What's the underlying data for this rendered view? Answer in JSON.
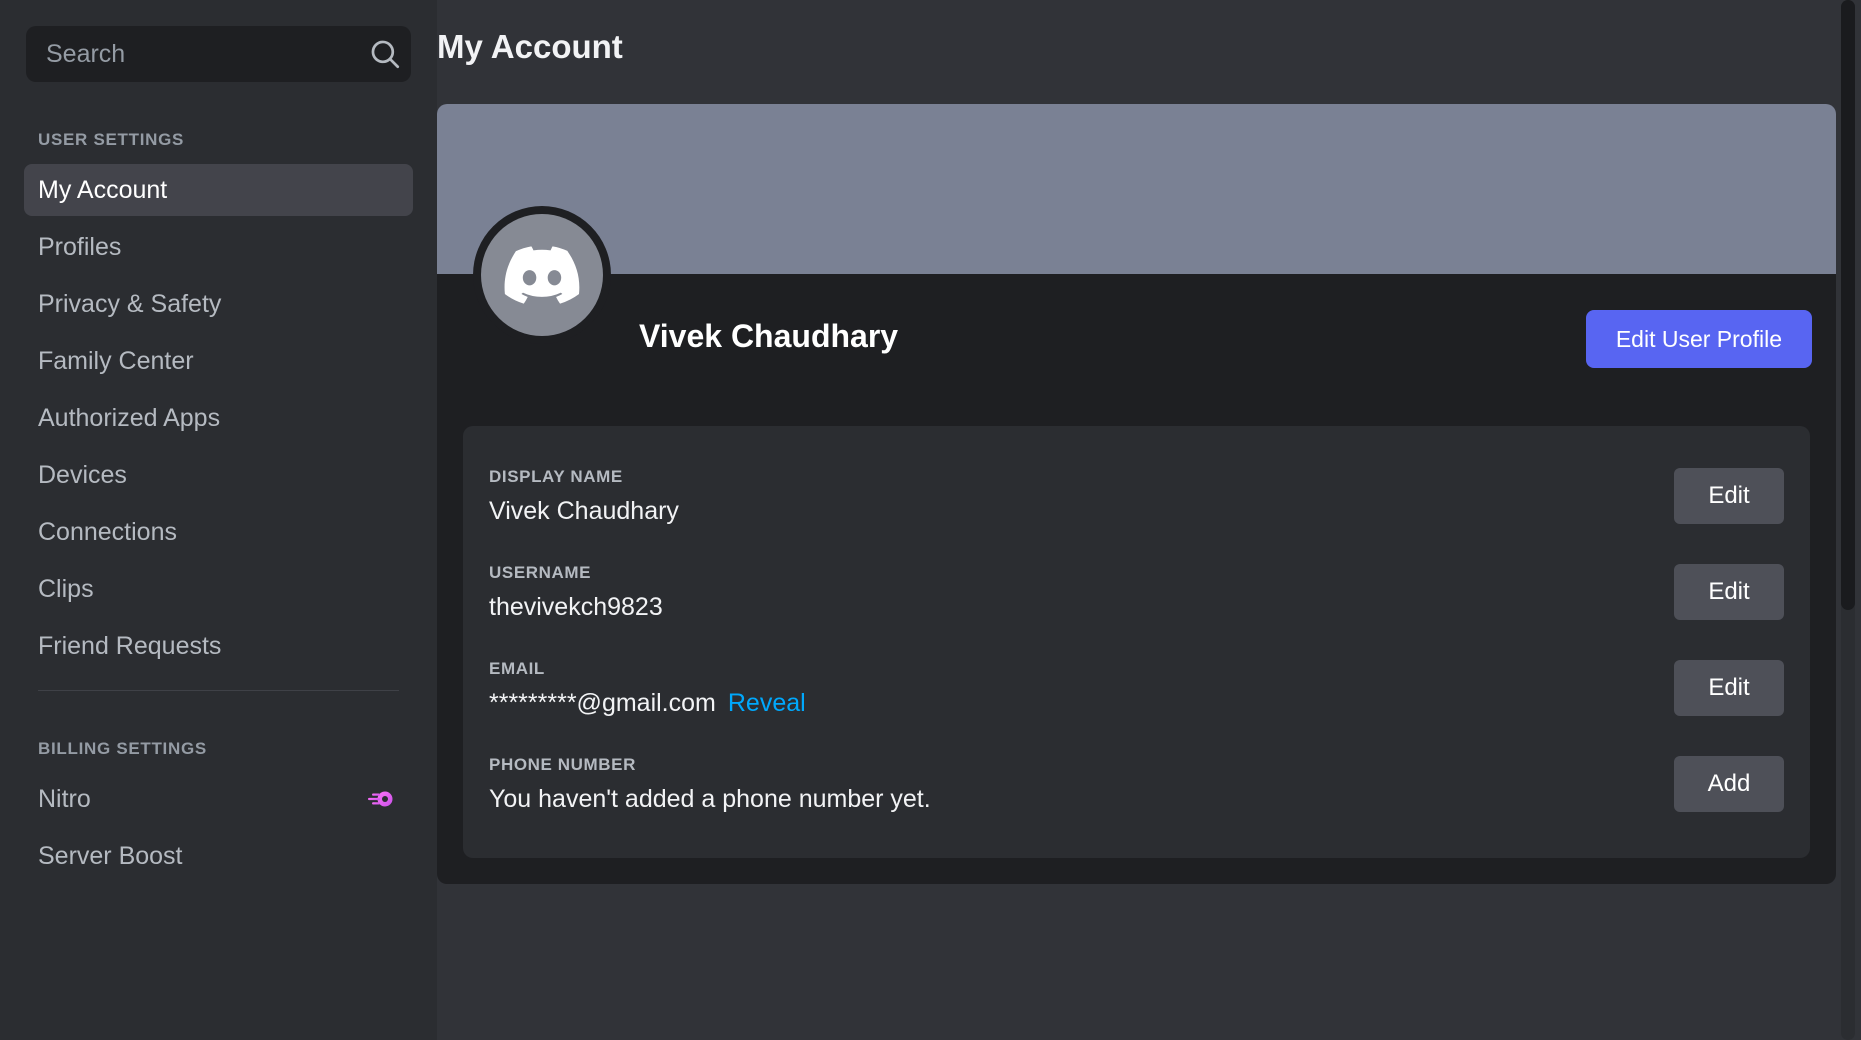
{
  "sidebar": {
    "search": {
      "placeholder": "Search",
      "value": "",
      "icon": "search-icon"
    },
    "sections": [
      {
        "heading": "USER SETTINGS",
        "items": [
          {
            "label": "My Account",
            "active": true
          },
          {
            "label": "Profiles",
            "active": false
          },
          {
            "label": "Privacy & Safety",
            "active": false
          },
          {
            "label": "Family Center",
            "active": false
          },
          {
            "label": "Authorized Apps",
            "active": false
          },
          {
            "label": "Devices",
            "active": false
          },
          {
            "label": "Connections",
            "active": false
          },
          {
            "label": "Clips",
            "active": false
          },
          {
            "label": "Friend Requests",
            "active": false
          }
        ]
      },
      {
        "heading": "BILLING SETTINGS",
        "items": [
          {
            "label": "Nitro",
            "active": false,
            "badge": "nitro-boost-icon"
          },
          {
            "label": "Server Boost",
            "active": false
          }
        ]
      }
    ]
  },
  "main": {
    "page_title": "My Account",
    "profile": {
      "display_name": "Vivek Chaudhary",
      "banner_color": "#7a8194",
      "avatar_icon": "discord-logo-icon",
      "edit_profile_label": "Edit User Profile",
      "edit_profile_color": "#5865f2"
    },
    "fields": [
      {
        "label": "DISPLAY NAME",
        "value": "Vivek Chaudhary",
        "action": "Edit",
        "link": null
      },
      {
        "label": "USERNAME",
        "value": "thevivekch9823",
        "action": "Edit",
        "link": null
      },
      {
        "label": "EMAIL",
        "value": "*********@gmail.com",
        "action": "Edit",
        "link": "Reveal",
        "link_color": "#00a8fc"
      },
      {
        "label": "PHONE NUMBER",
        "value": "You haven't added a phone number yet.",
        "action": "Add",
        "link": null
      }
    ]
  }
}
